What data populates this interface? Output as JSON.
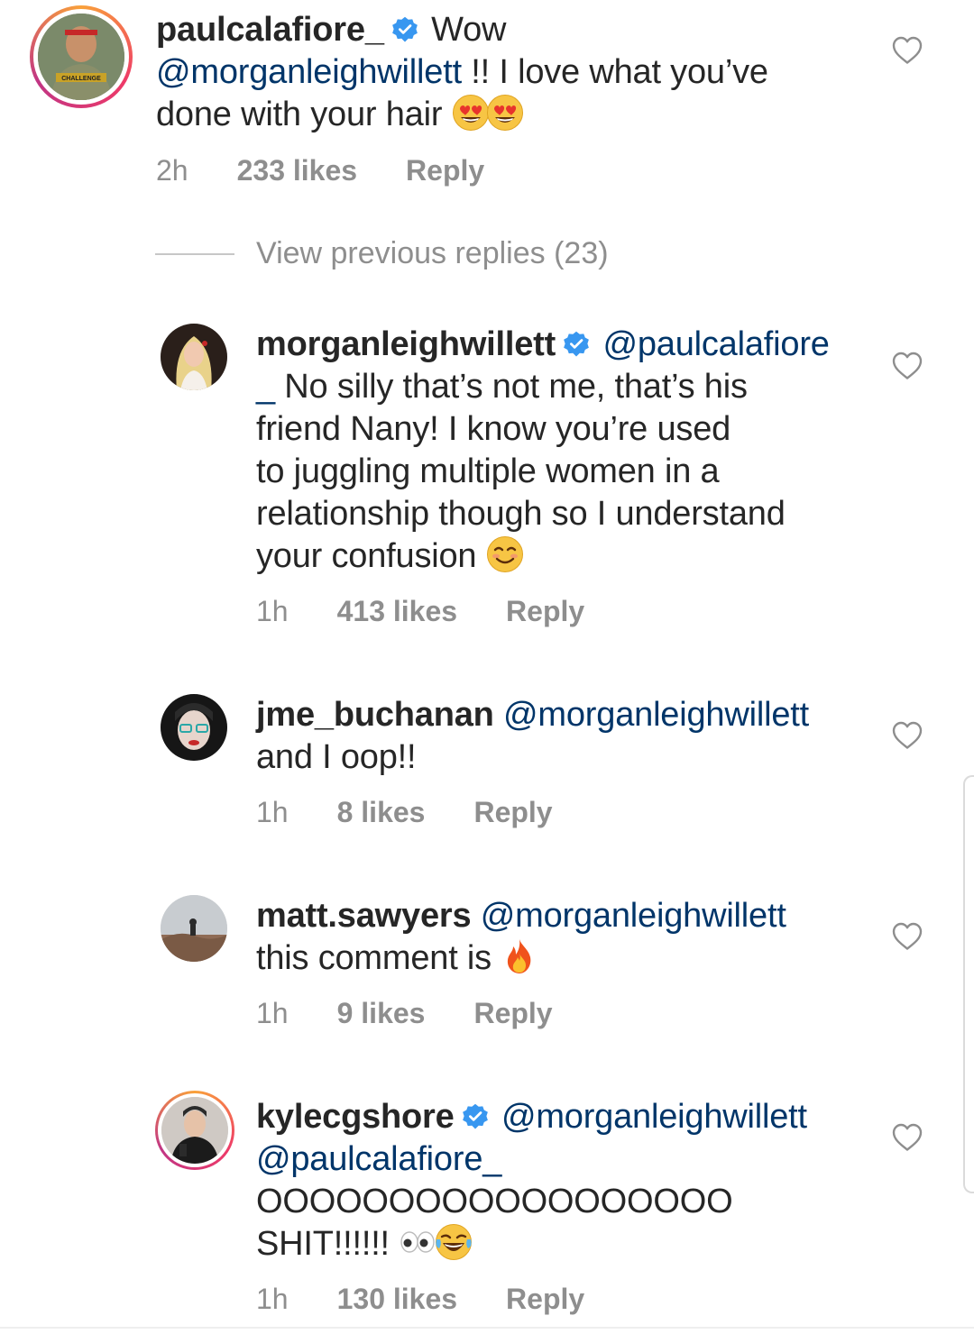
{
  "comments": [
    {
      "username": "paulcalafiore_",
      "verified": true,
      "lines": [
        "Wow",
        "@morganleighwillett !! I love what you’ve",
        "done with your hair"
      ],
      "time": "2h",
      "likes": "233 likes",
      "reply": "Reply",
      "avatar_text": "CHALLENGE"
    },
    {
      "username": "morganleighwillett",
      "verified": true,
      "mention": "@paulcalafiore",
      "lines": [
        "_ No silly that’s not me, that’s his",
        "friend Nany! I know you’re used",
        "to juggling multiple women in a",
        "relationship though so I understand",
        "your confusion"
      ],
      "time": "1h",
      "likes": "413 likes",
      "reply": "Reply"
    },
    {
      "username": "jme_buchanan",
      "verified": false,
      "mention": "@morganleighwillett",
      "lines": [
        "and I oop!!"
      ],
      "time": "1h",
      "likes": "8 likes",
      "reply": "Reply"
    },
    {
      "username": "matt.sawyers",
      "verified": false,
      "mention": "@morganleighwillett",
      "lines": [
        "this comment is"
      ],
      "time": "1h",
      "likes": "9 likes",
      "reply": "Reply"
    },
    {
      "username": "kylecgshore",
      "verified": true,
      "mention": "@morganleighwillett",
      "mention2": "@paulcalafiore_",
      "lines": [
        "OOOOOOOOOOOOOOOOOO",
        "SHIT!!!!!!"
      ],
      "time": "1h",
      "likes": "130 likes",
      "reply": "Reply"
    }
  ],
  "view_previous": "View previous replies (23)",
  "icons": {
    "like": "heart-outline-icon",
    "verified": "verified-badge-icon"
  },
  "colors": {
    "text": "#262626",
    "mention": "#003569",
    "meta": "#8e8e8e",
    "verified": "#3897f0"
  }
}
